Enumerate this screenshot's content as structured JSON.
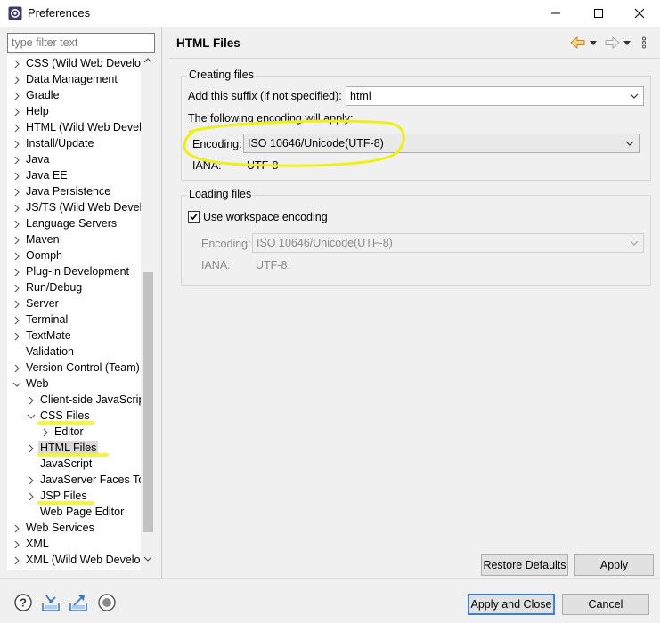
{
  "window": {
    "title": "Preferences"
  },
  "filter": {
    "placeholder": "type filter text"
  },
  "tree": [
    {
      "label": "CSS (Wild Web Developer)",
      "level": 0,
      "state": "collapsed"
    },
    {
      "label": "Data Management",
      "level": 0,
      "state": "collapsed"
    },
    {
      "label": "Gradle",
      "level": 0,
      "state": "collapsed"
    },
    {
      "label": "Help",
      "level": 0,
      "state": "collapsed"
    },
    {
      "label": "HTML (Wild Web Developer)",
      "level": 0,
      "state": "collapsed"
    },
    {
      "label": "Install/Update",
      "level": 0,
      "state": "collapsed"
    },
    {
      "label": "Java",
      "level": 0,
      "state": "collapsed"
    },
    {
      "label": "Java EE",
      "level": 0,
      "state": "collapsed"
    },
    {
      "label": "Java Persistence",
      "level": 0,
      "state": "collapsed"
    },
    {
      "label": "JS/TS (Wild Web Developer)",
      "level": 0,
      "state": "collapsed"
    },
    {
      "label": "Language Servers",
      "level": 0,
      "state": "collapsed"
    },
    {
      "label": "Maven",
      "level": 0,
      "state": "collapsed"
    },
    {
      "label": "Oomph",
      "level": 0,
      "state": "collapsed"
    },
    {
      "label": "Plug-in Development",
      "level": 0,
      "state": "collapsed"
    },
    {
      "label": "Run/Debug",
      "level": 0,
      "state": "collapsed"
    },
    {
      "label": "Server",
      "level": 0,
      "state": "collapsed"
    },
    {
      "label": "Terminal",
      "level": 0,
      "state": "collapsed"
    },
    {
      "label": "TextMate",
      "level": 0,
      "state": "collapsed"
    },
    {
      "label": "Validation",
      "level": 0,
      "state": "leaf"
    },
    {
      "label": "Version Control (Team)",
      "level": 0,
      "state": "collapsed"
    },
    {
      "label": "Web",
      "level": 0,
      "state": "expanded"
    },
    {
      "label": "Client-side JavaScript",
      "level": 1,
      "state": "collapsed"
    },
    {
      "label": "CSS Files",
      "level": 1,
      "state": "expanded",
      "mark": true
    },
    {
      "label": "Editor",
      "level": 2,
      "state": "collapsed"
    },
    {
      "label": "HTML Files",
      "level": 1,
      "state": "collapsed",
      "selected": true,
      "mark": true
    },
    {
      "label": "JavaScript",
      "level": 1,
      "state": "leaf"
    },
    {
      "label": "JavaServer Faces Tools",
      "level": 1,
      "state": "collapsed"
    },
    {
      "label": "JSP Files",
      "level": 1,
      "state": "collapsed",
      "mark": true
    },
    {
      "label": "Web Page Editor",
      "level": 1,
      "state": "leaf"
    },
    {
      "label": "Web Services",
      "level": 0,
      "state": "collapsed"
    },
    {
      "label": "XML",
      "level": 0,
      "state": "collapsed"
    },
    {
      "label": "XML (Wild Web Developer)",
      "level": 0,
      "state": "collapsed"
    }
  ],
  "page": {
    "title": "HTML Files"
  },
  "creating": {
    "group_title": "Creating files",
    "suffix_label": "Add this suffix (if not specified):",
    "suffix_value": "html",
    "encoding_note": "The following encoding will apply:",
    "encoding_label": "Encoding:",
    "encoding_value": "ISO 10646/Unicode(UTF-8)",
    "iana_label": "IANA:",
    "iana_value": "UTF-8"
  },
  "loading": {
    "group_title": "Loading files",
    "workspace_label": "Use workspace encoding",
    "workspace_checked": true,
    "encoding_label": "Encoding:",
    "encoding_value": "ISO 10646/Unicode(UTF-8)",
    "iana_label": "IANA:",
    "iana_value": "UTF-8"
  },
  "buttons": {
    "restore": "Restore Defaults",
    "apply": "Apply",
    "apply_close": "Apply and Close",
    "cancel": "Cancel"
  },
  "colors": {
    "highlight": "#f5f515",
    "accent": "#3c7fd8",
    "nav_arrow": "#e8a33b"
  }
}
